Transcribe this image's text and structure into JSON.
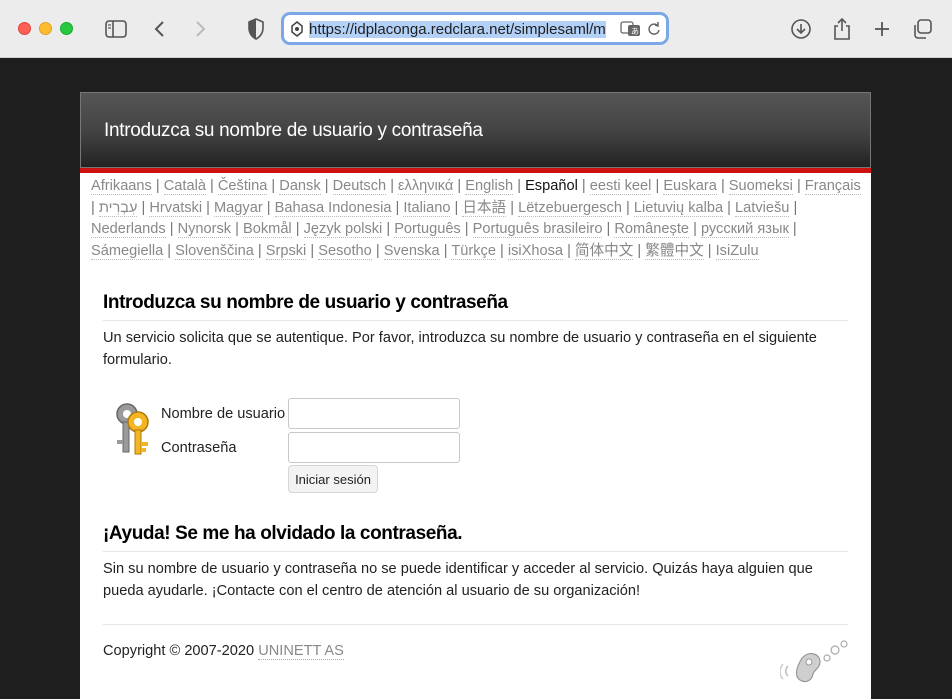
{
  "browser": {
    "url": "https://idplaconga.redclara.net/simplesaml/m"
  },
  "header": {
    "title": "Introduzca su nombre de usuario y contraseña"
  },
  "languages": {
    "items": [
      "Afrikaans",
      "Català",
      "Čeština",
      "Dansk",
      "Deutsch",
      "ελληνικά",
      "English",
      "Español",
      "eesti keel",
      "Euskara",
      "Suomeksi",
      "Français",
      "עִבְרִית",
      "Hrvatski",
      "Magyar",
      "Bahasa Indonesia",
      "Italiano",
      "日本語",
      "Lëtzebuergesch",
      "Lietuvių kalba",
      "Latviešu",
      "Nederlands",
      "Nynorsk",
      "Bokmål",
      "Język polski",
      "Português",
      "Português brasileiro",
      "Românește",
      "русский язык",
      "Sámegiella",
      "Slovenščina",
      "Srpski",
      "Sesotho",
      "Svenska",
      "Türkçe",
      "isiXhosa",
      "简体中文",
      "繁體中文",
      "IsiZulu"
    ],
    "current": "Español",
    "separator": "|"
  },
  "login": {
    "heading": "Introduzca su nombre de usuario y contraseña",
    "description": "Un servicio solicita que se autentique. Por favor, introduzca su nombre de usuario y contraseña en el siguiente formulario.",
    "username_label": "Nombre de usuario",
    "password_label": "Contraseña",
    "username_value": "",
    "password_value": "",
    "submit_label": "Iniciar sesión"
  },
  "help": {
    "heading": "¡Ayuda! Se me ha olvidado la contraseña.",
    "text": "Sin su nombre de usuario y contraseña no se puede identificar y acceder al servicio. Quizás haya alguien que pueda ayudarle. ¡Contacte con el centro de atención al usuario de su organización!"
  },
  "footer": {
    "copyright": "Copyright © 2007-2020",
    "company": "UNINETT AS"
  },
  "colors": {
    "header_bar": "#cc1111",
    "url_focus": "#7aa7e6"
  }
}
